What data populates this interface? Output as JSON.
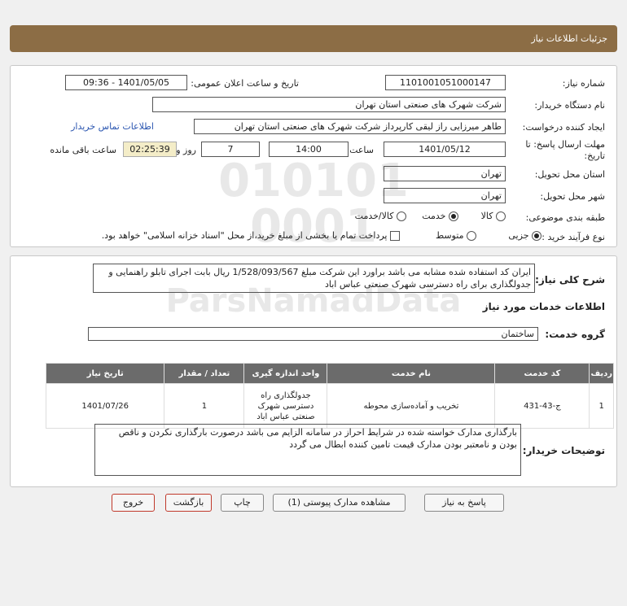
{
  "header": {
    "title": "جزئیات اطلاعات نیاز"
  },
  "info": {
    "need_no_label": "شماره نیاز:",
    "need_no": "1101001051000147",
    "announce_label": "تاریخ و ساعت اعلان عمومی:",
    "announce_value": "1401/05/05 - 09:36",
    "buyer_org_label": "نام دستگاه خریدار:",
    "buyer_org": "شرکت شهرک های صنعتی استان تهران",
    "creator_label": "ایجاد کننده درخواست:",
    "creator": "طاهر  میرزایی راز لیقی کارپرداز شرکت شهرک های صنعتی استان تهران",
    "contact_link": "اطلاعات تماس خریدار",
    "deadline_label_1": "مهلت ارسال پاسخ: تا",
    "deadline_label_2": "تاریخ:",
    "deadline_date": "1401/05/12",
    "time_label": "ساعت",
    "deadline_time": "14:00",
    "days": "7",
    "days_label": "روز و",
    "remaining": "02:25:39",
    "remaining_label": "ساعت باقی مانده",
    "province_label": "استان محل تحویل:",
    "province": "تهران",
    "city_label": "شهر محل تحویل:",
    "city": "تهران",
    "category_label": "طبقه بندی موضوعی:",
    "category_options": [
      "کالا",
      "خدمت",
      "کالا/خدمت"
    ],
    "category_selected": "خدمت",
    "process_label": "نوع فرآیند خرید :",
    "process_options": [
      "جزیی",
      "متوسط"
    ],
    "process_selected": "جزیی",
    "payment_note": "پرداخت تمام یا بخشی از مبلغ خرید،از محل \"اسناد خزانه اسلامی\" خواهد بود."
  },
  "details": {
    "summary_label": "شرح کلی نیاز:",
    "summary": "ایران کد استفاده شده مشابه می باشد براورد این شرکت مبلغ 1/528/093/567 ریال بابت اجرای تابلو راهنمایی و جدولگذاری برای راه دسترسی شهرک صنعتی عباس اباد",
    "services_title": "اطلاعات خدمات مورد نیاز",
    "group_label": "گروه خدمت:",
    "group": "ساختمان",
    "table": {
      "headers": [
        "ردیف",
        "کد خدمت",
        "نام خدمت",
        "واحد اندازه گیری",
        "تعداد / مقدار",
        "تاریخ نیاز"
      ],
      "rows": [
        [
          "1",
          "ج-43-431",
          "تخریب و آماده‌سازی محوطه",
          "جدولگذاری راه دسترسی شهرک صنعتی عباس اباد",
          "1",
          "1401/07/26"
        ]
      ]
    },
    "buyer_notes_label": "توضیحات خریدار:",
    "buyer_notes": "بارگذاری مدارک خواسته شده در شرایط احراز در سامانه الزایم می باشد درصورت بارگذاری نکردن و ناقص بودن و نامعتبر بودن مدارک قیمت تامین کننده ابطال می گردد"
  },
  "buttons": {
    "reply": "پاسخ به نیاز",
    "attachments": "مشاهده مدارک پیوستی (1)",
    "print": "چاپ",
    "back": "بازگشت",
    "exit": "خروج"
  },
  "watermark": {
    "brand": "ParsNamadData",
    "digits_1": "010101",
    "digits_2": "0001"
  }
}
